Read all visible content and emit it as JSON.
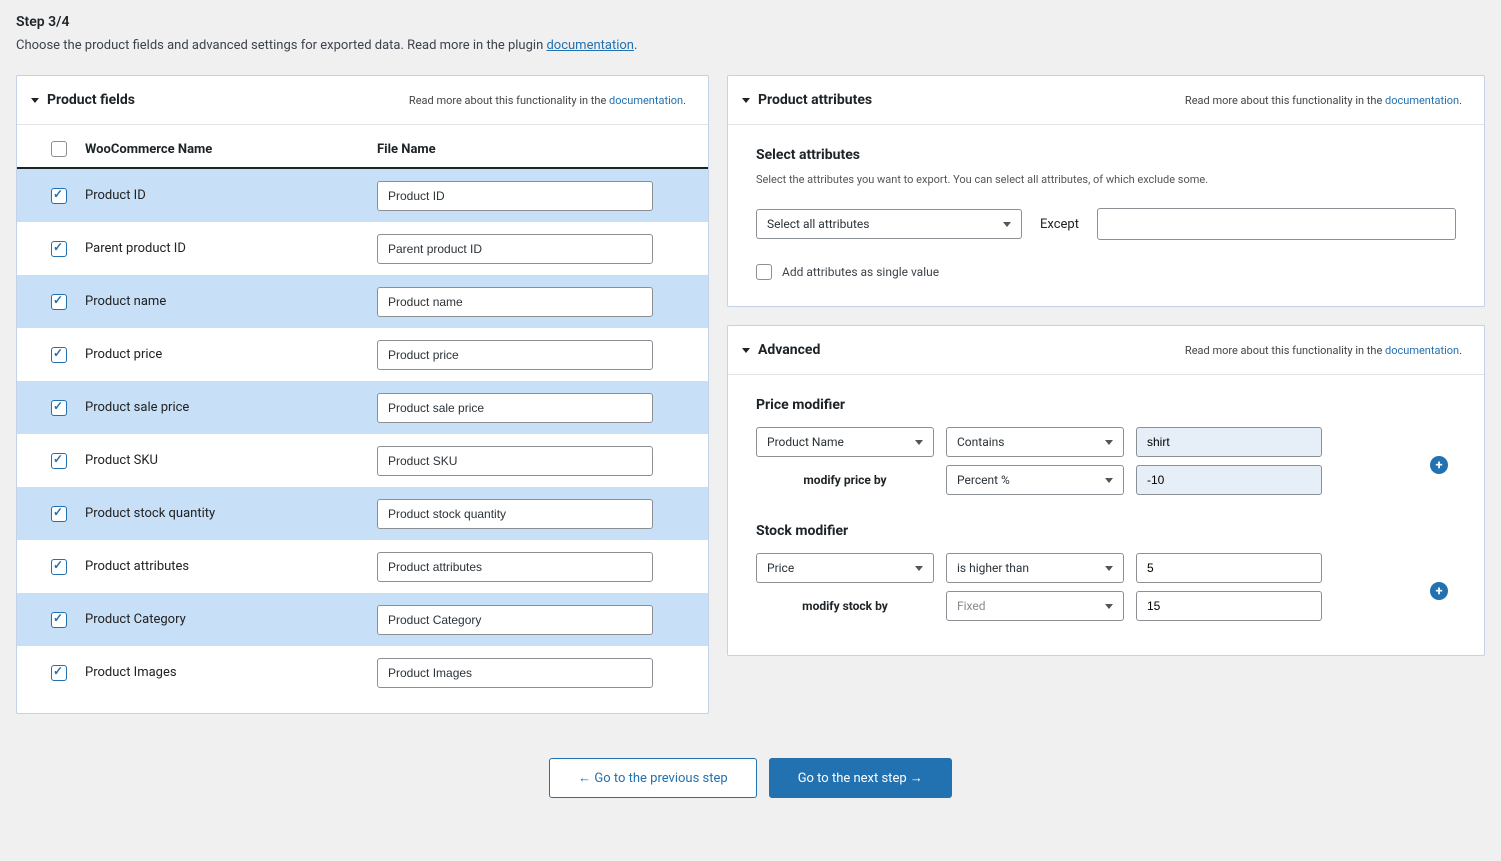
{
  "step": {
    "title": "Step 3/4",
    "subtitle_pre": "Choose the product fields and advanced settings for exported data. Read more in the plugin ",
    "subtitle_link": "documentation",
    "subtitle_post": "."
  },
  "panels": {
    "fields": {
      "title": "Product fields",
      "hint_pre": "Read more about this functionality in the ",
      "hint_link": "documentation",
      "hint_post": ".",
      "head_woo": "WooCommerce Name",
      "head_file": "File Name",
      "rows": [
        {
          "label": "Product ID",
          "file": "Product ID"
        },
        {
          "label": "Parent product ID",
          "file": "Parent product ID"
        },
        {
          "label": "Product name",
          "file": "Product name"
        },
        {
          "label": "Product price",
          "file": "Product price"
        },
        {
          "label": "Product sale price",
          "file": "Product sale price"
        },
        {
          "label": "Product SKU",
          "file": "Product SKU"
        },
        {
          "label": "Product stock quantity",
          "file": "Product stock quantity"
        },
        {
          "label": "Product attributes",
          "file": "Product attributes"
        },
        {
          "label": "Product Category",
          "file": "Product Category"
        },
        {
          "label": "Product Images",
          "file": "Product Images"
        }
      ]
    },
    "attrs": {
      "title": "Product attributes",
      "hint_pre": "Read more about this functionality in the ",
      "hint_link": "documentation",
      "hint_post": ".",
      "section_title": "Select attributes",
      "section_sub": "Select the attributes you want to export. You can select all attributes, of which exclude some.",
      "select_label": "Select all attributes",
      "except_label": "Except",
      "single_value_label": "Add attributes as single value"
    },
    "adv": {
      "title": "Advanced",
      "hint_pre": "Read more about this functionality in the ",
      "hint_link": "documentation",
      "hint_post": ".",
      "price_title": "Price modifier",
      "price_field": "Product Name",
      "price_op": "Contains",
      "price_val": "shirt",
      "price_modify_label": "modify price by",
      "price_modify_type": "Percent %",
      "price_modify_val": "-10",
      "stock_title": "Stock modifier",
      "stock_field": "Price",
      "stock_op": "is higher than",
      "stock_val": "5",
      "stock_modify_label": "modify stock by",
      "stock_modify_type": "Fixed",
      "stock_modify_val": "15"
    }
  },
  "footer": {
    "prev": "← Go to the previous step",
    "next": "Go to the next step →"
  }
}
